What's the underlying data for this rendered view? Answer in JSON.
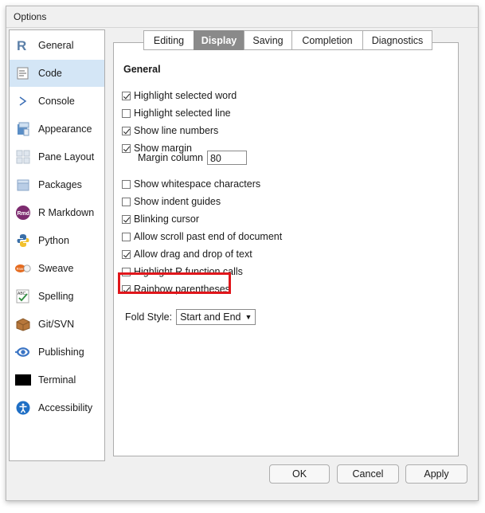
{
  "window": {
    "title": "Options"
  },
  "sidebar": {
    "items": [
      {
        "label": "General",
        "icon": "r-logo-icon"
      },
      {
        "label": "Code",
        "icon": "code-icon"
      },
      {
        "label": "Console",
        "icon": "console-icon"
      },
      {
        "label": "Appearance",
        "icon": "appearance-icon"
      },
      {
        "label": "Pane Layout",
        "icon": "pane-layout-icon"
      },
      {
        "label": "Packages",
        "icon": "packages-icon"
      },
      {
        "label": "R Markdown",
        "icon": "rmd-icon"
      },
      {
        "label": "Python",
        "icon": "python-icon"
      },
      {
        "label": "Sweave",
        "icon": "sweave-icon"
      },
      {
        "label": "Spelling",
        "icon": "spelling-icon"
      },
      {
        "label": "Git/SVN",
        "icon": "git-svn-icon"
      },
      {
        "label": "Publishing",
        "icon": "publishing-icon"
      },
      {
        "label": "Terminal",
        "icon": "terminal-icon"
      },
      {
        "label": "Accessibility",
        "icon": "accessibility-icon"
      }
    ],
    "selected": "Code"
  },
  "tabs": [
    {
      "label": "Editing"
    },
    {
      "label": "Display"
    },
    {
      "label": "Saving"
    },
    {
      "label": "Completion"
    },
    {
      "label": "Diagnostics"
    }
  ],
  "active_tab": "Display",
  "section": {
    "title": "General"
  },
  "options": [
    {
      "label": "Highlight selected word",
      "checked": true
    },
    {
      "label": "Highlight selected line",
      "checked": false
    },
    {
      "label": "Show line numbers",
      "checked": true
    },
    {
      "label": "Show margin",
      "checked": true
    },
    {
      "label": "Show whitespace characters",
      "checked": false
    },
    {
      "label": "Show indent guides",
      "checked": false
    },
    {
      "label": "Blinking cursor",
      "checked": true
    },
    {
      "label": "Allow scroll past end of document",
      "checked": false
    },
    {
      "label": "Allow drag and drop of text",
      "checked": true
    },
    {
      "label": "Highlight R function calls",
      "checked": false
    },
    {
      "label": "Rainbow parentheses",
      "checked": true
    }
  ],
  "margin_column": {
    "label": "Margin column",
    "value": "80"
  },
  "fold_style": {
    "label": "Fold Style:",
    "value": "Start and End"
  },
  "buttons": {
    "ok": "OK",
    "cancel": "Cancel",
    "apply": "Apply"
  },
  "colors": {
    "highlight": "#e0161b",
    "selected_sidebar": "#d4e6f6",
    "active_tab": "#8a8a8a"
  }
}
